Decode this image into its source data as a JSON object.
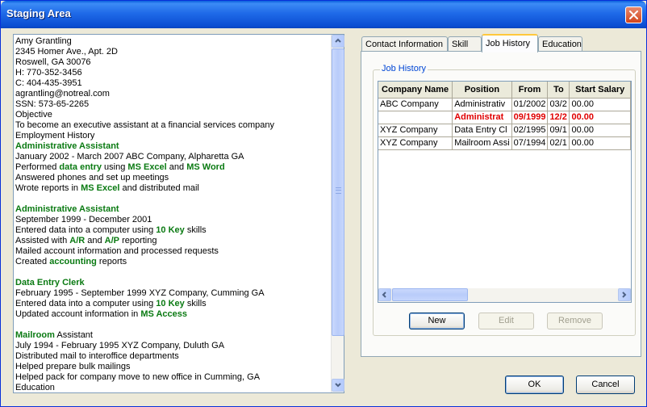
{
  "window": {
    "title": "Staging Area"
  },
  "resume": {
    "lines": [
      [
        {
          "t": "Amy Grantling"
        }
      ],
      [
        {
          "t": "2345 Homer Ave., Apt. 2D"
        }
      ],
      [
        {
          "t": "Roswell, GA  30076"
        }
      ],
      [
        {
          "t": "H: 770-352-3456"
        }
      ],
      [
        {
          "t": "C: 404-435-3951"
        }
      ],
      [
        {
          "t": "agrantling@notreal.com"
        }
      ],
      [
        {
          "t": "SSN: 573-65-2265"
        }
      ],
      [
        {
          "t": "Objective"
        }
      ],
      [
        {
          "t": "To become an executive assistant at a financial services company"
        }
      ],
      [
        {
          "t": "Employment History"
        }
      ],
      [
        {
          "t": "Administrative Assistant",
          "k": true
        }
      ],
      [
        {
          "t": "January 2002 - March 2007  ABC Company, Alpharetta GA"
        }
      ],
      [
        {
          "t": "Performed "
        },
        {
          "t": "data entry",
          "k": true
        },
        {
          "t": " using "
        },
        {
          "t": "MS Excel",
          "k": true
        },
        {
          "t": " and "
        },
        {
          "t": "MS Word",
          "k": true
        }
      ],
      [
        {
          "t": "Answered phones and set up meetings"
        }
      ],
      [
        {
          "t": "Wrote reports in "
        },
        {
          "t": "MS Excel",
          "k": true
        },
        {
          "t": " and distributed mail"
        }
      ],
      [
        {
          "t": ""
        }
      ],
      [
        {
          "t": "Administrative Assistant",
          "k": true
        }
      ],
      [
        {
          "t": "September 1999 - December 2001"
        }
      ],
      [
        {
          "t": "Entered data into a computer using "
        },
        {
          "t": "10 Key",
          "k": true
        },
        {
          "t": " skills"
        }
      ],
      [
        {
          "t": "Assisted with "
        },
        {
          "t": "A/R",
          "k": true
        },
        {
          "t": " and "
        },
        {
          "t": "A/P",
          "k": true
        },
        {
          "t": " reporting"
        }
      ],
      [
        {
          "t": "Mailed account information and processed requests"
        }
      ],
      [
        {
          "t": "Created "
        },
        {
          "t": "accounting",
          "k": true
        },
        {
          "t": " reports"
        }
      ],
      [
        {
          "t": ""
        }
      ],
      [
        {
          "t": "Data Entry Clerk",
          "k": true
        }
      ],
      [
        {
          "t": "February 1995 - September 1999  XYZ Company, Cumming GA"
        }
      ],
      [
        {
          "t": "Entered data into a computer using "
        },
        {
          "t": "10 Key",
          "k": true
        },
        {
          "t": " skills"
        }
      ],
      [
        {
          "t": "Updated account information in "
        },
        {
          "t": "MS Access",
          "k": true
        }
      ],
      [
        {
          "t": ""
        }
      ],
      [
        {
          "t": "Mailroom",
          "k": true
        },
        {
          "t": " Assistant"
        }
      ],
      [
        {
          "t": "July 1994 - February 1995  XYZ Company, Duluth GA"
        }
      ],
      [
        {
          "t": "Distributed mail to interoffice departments"
        }
      ],
      [
        {
          "t": "Helped prepare bulk mailings"
        }
      ],
      [
        {
          "t": "Helped pack for company move to new office in Cumming, GA"
        }
      ],
      [
        {
          "t": "Education"
        }
      ]
    ]
  },
  "tabs": [
    "Contact Information",
    "Skill",
    "Job History",
    "Education"
  ],
  "active_tab": "Job History",
  "job_history": {
    "group_title": "Job History",
    "columns": [
      "Company Name",
      "Position",
      "From",
      "To",
      "Start Salary"
    ],
    "rows": [
      {
        "cells": [
          "ABC Company",
          "Administrativ",
          "01/2002",
          "03/2",
          "00.00"
        ],
        "selected": false
      },
      {
        "cells": [
          "",
          "Administrat",
          "09/1999",
          "12/2",
          "00.00"
        ],
        "selected": true
      },
      {
        "cells": [
          "XYZ Company",
          "Data Entry Cl",
          "02/1995",
          "09/1",
          "00.00"
        ],
        "selected": false
      },
      {
        "cells": [
          "XYZ Company",
          "Mailroom Assi",
          "07/1994",
          "02/1",
          "00.00"
        ],
        "selected": false
      }
    ],
    "buttons": {
      "new": "New",
      "edit": "Edit",
      "remove": "Remove"
    }
  },
  "dialog_buttons": {
    "ok": "OK",
    "cancel": "Cancel"
  }
}
